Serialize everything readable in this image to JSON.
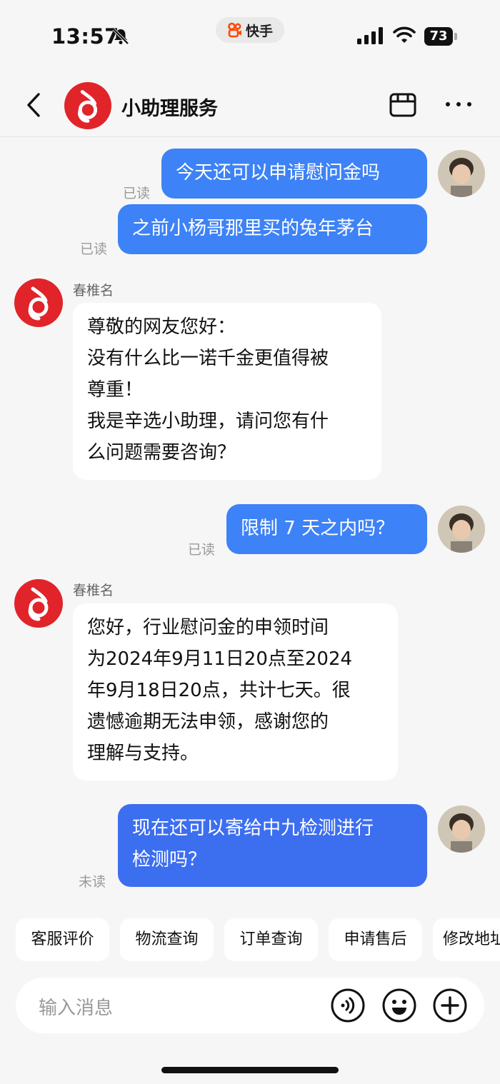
{
  "status": {
    "time": "13:57",
    "app": "快手",
    "battery": "73"
  },
  "header": {
    "title": "小助理服务"
  },
  "messages": {
    "m1": {
      "text": "今天还可以申请慰问金吗",
      "status": "已读"
    },
    "m2": {
      "text": "之前小杨哥那里买的兔年茅台",
      "status": "已读"
    },
    "m3": {
      "sender": "春椎名",
      "lines": [
        "尊敬的网友您好：",
        "没有什么比一诺千金更值得被",
        "尊重！",
        "我是辛选小助理，请问您有什",
        "么问题需要咨询？"
      ]
    },
    "m4": {
      "text": "限制 7 天之内吗？",
      "status": "已读"
    },
    "m5": {
      "sender": "春椎名",
      "lines": [
        "您好，行业慰问金的申领时间",
        "为2024年9月11日20点至2024",
        "年9月18日20点，共计七天。很",
        "遗憾逾期无法申领，感谢您的",
        "理解与支持。"
      ]
    },
    "m6": {
      "lines": [
        "现在还可以寄给中九检测进行",
        "检测吗？"
      ],
      "status": "未读"
    }
  },
  "quick_actions": [
    "客服评价",
    "物流查询",
    "订单查询",
    "申请售后",
    "修改地址"
  ],
  "input": {
    "placeholder": "输入消息"
  },
  "colors": {
    "outgoing": "#3d82f6",
    "brand_red": "#e0242a"
  },
  "icons": [
    "back-icon",
    "store-icon",
    "more-icon",
    "voice-icon",
    "emoji-icon",
    "plus-icon"
  ]
}
